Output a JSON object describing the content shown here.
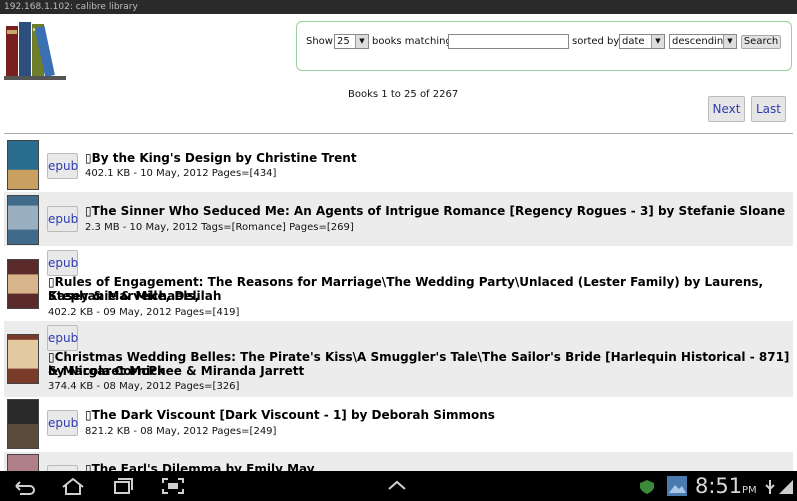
{
  "statusbar": {
    "text": "192.168.1.102: calibre library"
  },
  "search": {
    "show_label": "Show",
    "count_value": "25",
    "books_matching_label": "books matching",
    "query_value": "",
    "sorted_by_label": "sorted by",
    "sort_field": "date",
    "sort_order": "descending",
    "search_button": "Search"
  },
  "results": {
    "summary": "Books 1 to 25 of 2267",
    "next_label": "Next",
    "last_label": "Last"
  },
  "books": [
    {
      "title": "By the King's Design by Christine Trent",
      "meta": "402.1 KB - 10 May, 2012 Pages=[434]",
      "format": "epub"
    },
    {
      "title": "The Sinner Who Seduced Me: An Agents of Intrigue Romance [Regency Rogues - 3] by Stefanie Sloane",
      "meta": "2.3 MB - 10 May, 2012 Tags=[Romance] Pages=[269]",
      "format": "epub"
    },
    {
      "title_line1": "Rules of Engagement: The Reasons for Marriage\\The Wedding Party\\Unlaced (Lester Family) by Laurens, Stephanie & Michaels,",
      "title_line2": "Kasey & Marvelle, Delilah",
      "meta": "402.2 KB - 09 May, 2012 Pages=[419]",
      "format": "epub"
    },
    {
      "title_line1": "Christmas Wedding Belles: The Pirate's Kiss\\A Smuggler's Tale\\The Sailor's Bride [Harlequin Historical - 871] by Nicola Cornick",
      "title_line2": "& Margaret McPhee & Miranda Jarrett",
      "meta": "374.4 KB - 08 May, 2012 Pages=[326]",
      "format": "epub"
    },
    {
      "title": "The Dark Viscount [Dark Viscount - 1] by Deborah Simmons",
      "meta": "821.2 KB - 08 May, 2012 Pages=[249]",
      "format": "epub"
    },
    {
      "title": "The Earl's Dilemma by Emily May"
    }
  ],
  "systembar": {
    "time": "8:51",
    "ampm": "PM"
  },
  "colors": {
    "accent": "#2d3bb0",
    "border_green": "#9bcf9b",
    "row_alt": "#ececec"
  }
}
